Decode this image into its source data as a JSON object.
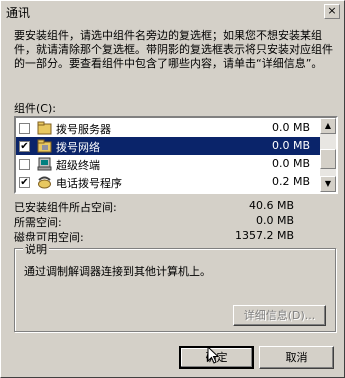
{
  "window": {
    "title": "通讯",
    "close_label": "×"
  },
  "description": "要安装组件，请选中组件名旁边的复选框；如果您不想安装某组件，就请清除那个复选框。带阴影的复选框表示将只安装对应组件的一部分。要查看组件中包含了哪些内容，请单击“详细信息”。",
  "components_label": "组件(C):",
  "components": [
    {
      "name": "拨号服务器",
      "size": "0.0 MB",
      "checked": false,
      "selected": false,
      "icon": "folder-icon"
    },
    {
      "name": "拨号网络",
      "size": "0.0 MB",
      "checked": true,
      "selected": true,
      "icon": "network-icon"
    },
    {
      "name": "超级终端",
      "size": "0.0 MB",
      "checked": false,
      "selected": false,
      "icon": "terminal-icon"
    },
    {
      "name": "电话拨号程序",
      "size": "0.2 MB",
      "checked": true,
      "selected": false,
      "icon": "phone-icon"
    }
  ],
  "stats": {
    "installed_label": "已安装组件所占空间:",
    "installed_value": "40.6 MB",
    "required_label": "所需空间:",
    "required_value": "0.0 MB",
    "free_label": "磁盘可用空间:",
    "free_value": "1357.2 MB"
  },
  "explanation": {
    "title": "说明",
    "text": "通过调制解调器连接到其他计算机上。"
  },
  "buttons": {
    "details": "详细信息(D)...",
    "ok": "确定",
    "cancel": "取消"
  }
}
